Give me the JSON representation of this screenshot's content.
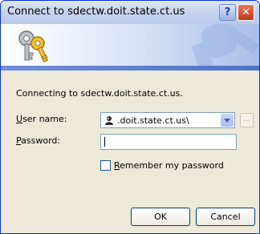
{
  "window": {
    "title": "Connect to sdectw.doit.state.ct.us"
  },
  "titlebar": {
    "help_label": "?",
    "close_label": "✕"
  },
  "banner": {
    "icon": "keys-icon"
  },
  "form": {
    "connecting_text": "Connecting to sdectw.doit.state.ct.us.",
    "user_label_first": "U",
    "user_label_rest": "ser name:",
    "user_value": ".doit.state.ct.us\\",
    "browse_label": "...",
    "password_label_first": "P",
    "password_label_rest": "assword:",
    "password_value": "",
    "remember_first": "R",
    "remember_rest": "emember my password",
    "remember_checked": false
  },
  "buttons": {
    "ok": "OK",
    "cancel": "Cancel"
  },
  "colors": {
    "title_border": "#0831d9",
    "close": "#c0391d",
    "dialog_bg": "#ece9d8"
  }
}
